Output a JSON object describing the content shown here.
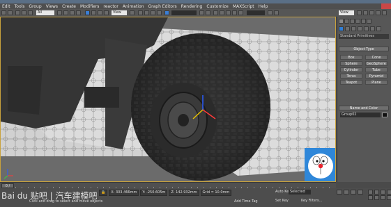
{
  "menu": [
    "Edit",
    "Tools",
    "Group",
    "Views",
    "Create",
    "Modifiers",
    "reactor",
    "Animation",
    "Graph Editors",
    "Rendering",
    "Customize",
    "MAXScript",
    "Help"
  ],
  "toolbar": {
    "filter": "All",
    "reference": "View",
    "named_selection": "",
    "right_view": "View"
  },
  "command_panel": {
    "category": "Standard Primitives",
    "object_type_header": "Object Type",
    "object_buttons": [
      "Box",
      "Cone",
      "Sphere",
      "GeoSphere",
      "Cylinder",
      "Tube",
      "Torus",
      "Pyramid",
      "Teapot",
      "Plane"
    ],
    "name_color_header": "Name and Color",
    "object_name": "Group02",
    "object_color": "#111111"
  },
  "timeline": {
    "frame": "0 / 100"
  },
  "status": {
    "watermark": "Bai du 贴吧  |  汽车建模吧",
    "x_value": "303.466mm",
    "y_value": "-250.605m",
    "z_value": "142.932mm",
    "grid": "Grid = 10.0mm",
    "prompt": "Click and drag to select and move objects",
    "add_time_tag": "Add Time Tag",
    "auto_key": "Auto Key",
    "selected": "Selected",
    "set_key": "Set Key",
    "key_filters": "Key Filters..."
  },
  "colors": {
    "viewport_border": "#c9a23c",
    "accent": "#2f7fd8"
  }
}
